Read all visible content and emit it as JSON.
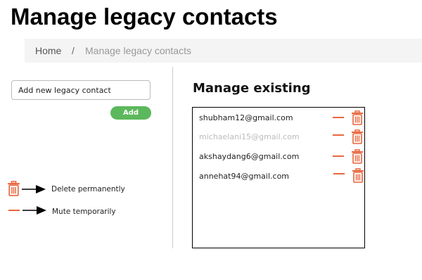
{
  "page": {
    "title": "Manage legacy contacts"
  },
  "breadcrumb": {
    "home": "Home",
    "separator": "/",
    "current": "Manage legacy contacts"
  },
  "add_form": {
    "input_value": "Add new legacy contact",
    "add_label": "Add"
  },
  "existing": {
    "heading": "Manage existing",
    "contacts": [
      {
        "email": "shubham12@gmail.com",
        "muted": false
      },
      {
        "email": "michaelani15@gmail.com",
        "muted": true
      },
      {
        "email": "akshaydang6@gmail.com",
        "muted": false
      },
      {
        "email": "annehat94@gmail.com",
        "muted": false
      }
    ]
  },
  "legend": {
    "delete_label": "Delete permanently",
    "mute_label": "Mute temporarily"
  },
  "colors": {
    "accent": "#e9663e",
    "add_button": "#5cb85c",
    "muted_text": "#bbbbbb"
  },
  "icons": {
    "delete": "trash-icon",
    "mute": "minus-icon",
    "arrow": "arrow-right-icon"
  }
}
